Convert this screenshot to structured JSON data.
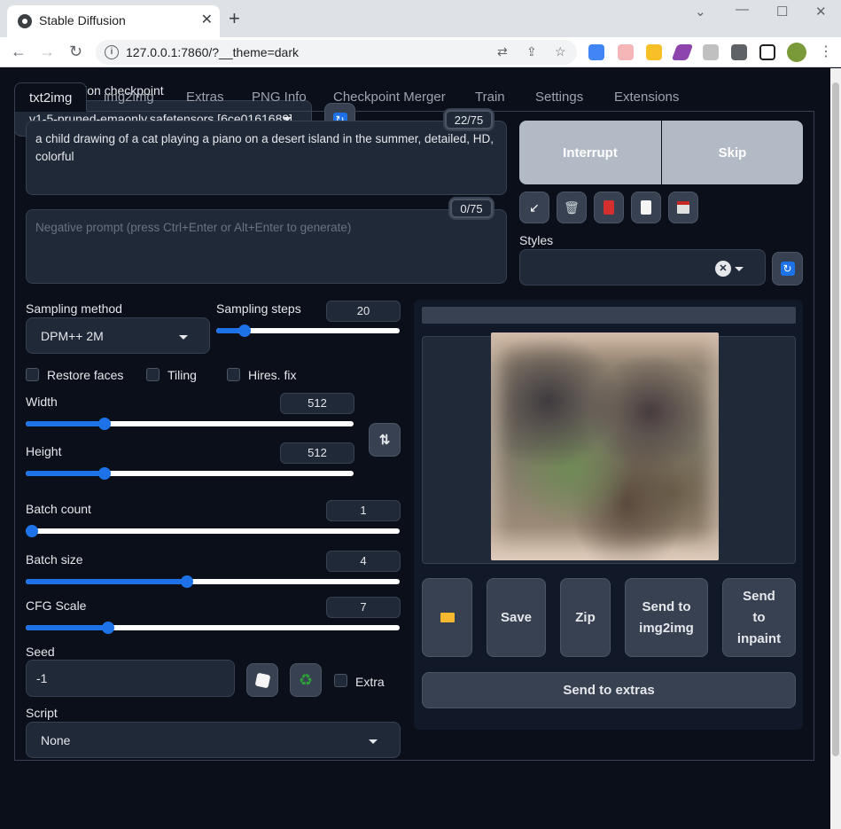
{
  "browser": {
    "tab_title": "Stable Diffusion",
    "url": "127.0.0.1:7860/?__theme=dark"
  },
  "checkpoint": {
    "label": "Stable Diffusion checkpoint",
    "value": "v1-5-pruned-emaonly.safetensors [6ce0161689]"
  },
  "tabs": [
    "txt2img",
    "img2img",
    "Extras",
    "PNG Info",
    "Checkpoint Merger",
    "Train",
    "Settings",
    "Extensions"
  ],
  "prompt": {
    "text": "a child drawing of a cat playing a piano on a desert island in the summer, detailed, HD, colorful",
    "counter": "22/75"
  },
  "negative_prompt": {
    "placeholder": "Negative prompt (press Ctrl+Enter or Alt+Enter to generate)",
    "counter": "0/75"
  },
  "actions": {
    "interrupt": "Interrupt",
    "skip": "Skip"
  },
  "styles": {
    "label": "Styles",
    "value": ""
  },
  "sampling": {
    "method_label": "Sampling method",
    "method_value": "DPM++ 2M",
    "steps_label": "Sampling steps",
    "steps_value": "20",
    "steps_fraction": 0.13
  },
  "checkboxes": {
    "restore_faces": "Restore faces",
    "tiling": "Tiling",
    "hires_fix": "Hires. fix",
    "extra": "Extra"
  },
  "width": {
    "label": "Width",
    "value": "512",
    "fraction": 0.23
  },
  "height": {
    "label": "Height",
    "value": "512",
    "fraction": 0.23
  },
  "batch_count": {
    "label": "Batch count",
    "value": "1",
    "fraction": 0.0
  },
  "batch_size": {
    "label": "Batch size",
    "value": "4",
    "fraction": 0.43
  },
  "cfg_scale": {
    "label": "CFG Scale",
    "value": "7",
    "fraction": 0.21
  },
  "seed": {
    "label": "Seed",
    "value": "-1"
  },
  "script": {
    "label": "Script",
    "value": "None"
  },
  "output_buttons": {
    "save": "Save",
    "zip": "Zip",
    "send_img2img": "Send to img2img",
    "send_inpaint": "Send to inpaint",
    "send_extras": "Send to extras"
  },
  "colors": {
    "accent": "#1d72e8",
    "background": "#0b0f19",
    "panel": "#1f2937",
    "interrupt_button": "#b1bac5"
  }
}
